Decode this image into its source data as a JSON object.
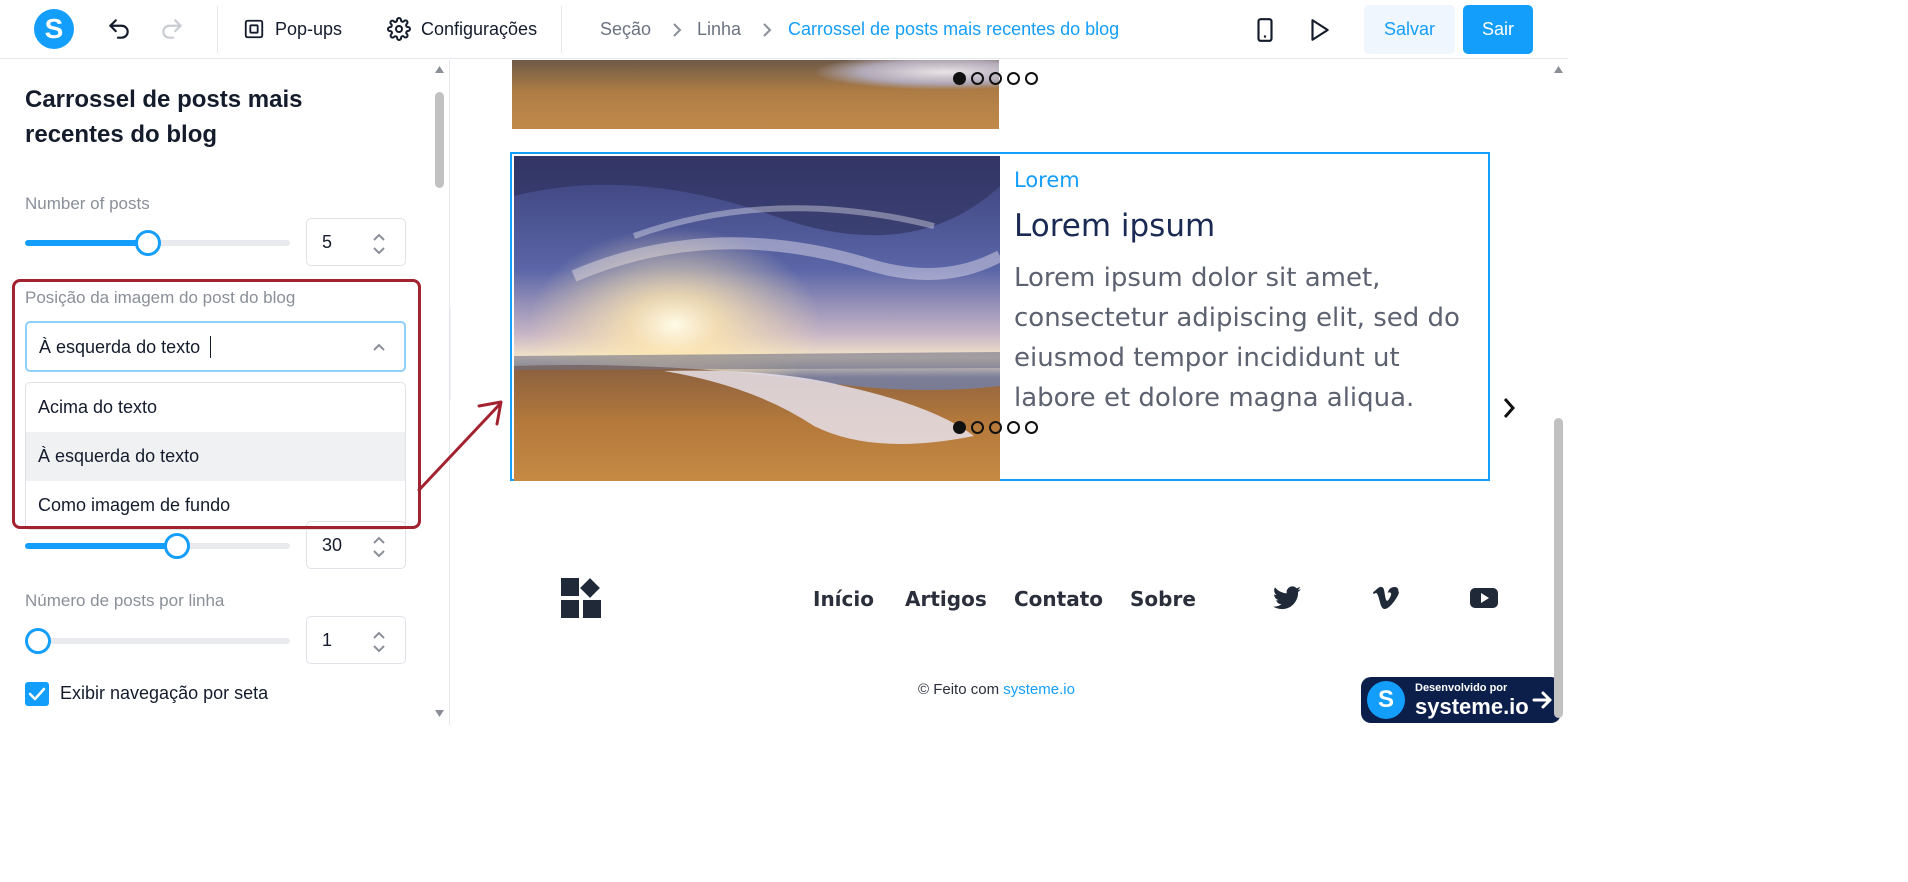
{
  "topbar": {
    "logo_letter": "S",
    "popups_label": "Pop-ups",
    "settings_label": "Configurações",
    "breadcrumbs": [
      "Seção",
      "Linha",
      "Carrossel de posts mais recentes do blog"
    ],
    "save_label": "Salvar",
    "exit_label": "Sair"
  },
  "panel": {
    "title": "Carrossel de posts mais recentes do blog",
    "number_of_posts": {
      "label": "Number of posts",
      "value": "5",
      "slider_fraction": 0.46
    },
    "image_position": {
      "label": "Posição da imagem do post do blog",
      "selected": "À esquerda do texto",
      "options": [
        "Acima do texto",
        "À esquerda do texto",
        "Como imagem de fundo"
      ],
      "selected_index": 1
    },
    "hidden_slider": {
      "value": "30",
      "slider_fraction": 0.58
    },
    "posts_per_line": {
      "label": "Número de posts por linha",
      "value": "1",
      "slider_fraction": 0.0
    },
    "show_arrows": {
      "label": "Exibir navegação por seta",
      "checked": true
    }
  },
  "canvas": {
    "post": {
      "category": "Lorem",
      "title": "Lorem ipsum",
      "text": "Lorem ipsum dolor sit amet, consectetur adipiscing elit, sed do eiusmod tempor incididunt ut labore et dolore magna aliqua."
    },
    "footer_nav": [
      "Início",
      "Artigos",
      "Contato",
      "Sobre"
    ],
    "social_icons": [
      "twitter-icon",
      "vimeo-icon",
      "youtube-icon"
    ],
    "copyright_prefix": "© Feito com ",
    "copyright_link": "systeme.io",
    "badge": {
      "small": "Desenvolvido por",
      "big": "systeme.io",
      "letter": "S"
    }
  },
  "colors": {
    "accent": "#149efc",
    "highlight": "#a3222f",
    "badge_bg": "#0b1f4a"
  }
}
